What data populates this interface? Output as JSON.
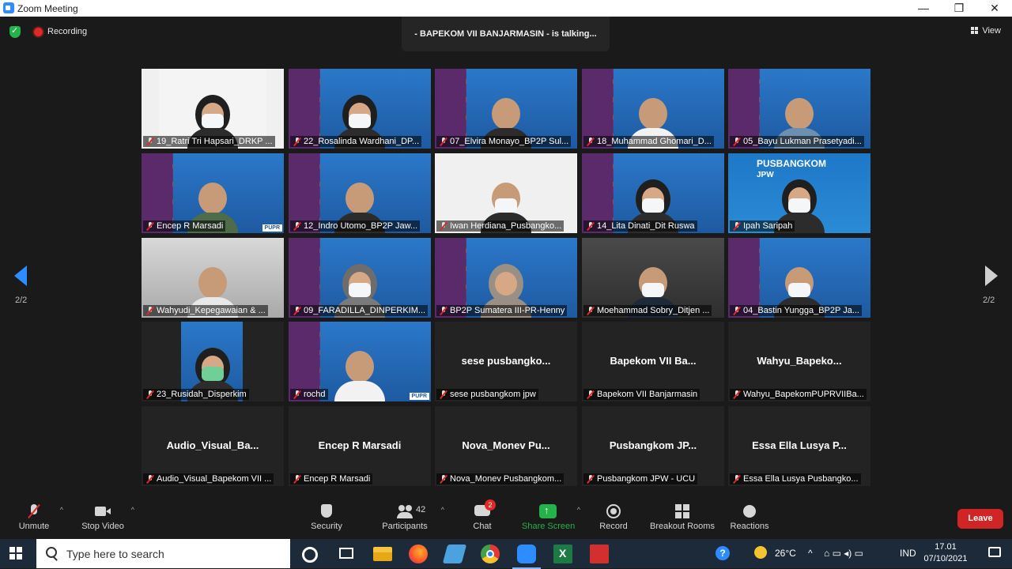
{
  "window": {
    "title": "Zoom Meeting"
  },
  "top": {
    "recording_label": "Recording",
    "talking": "- BAPEKOM VII BANJARMASIN - is talking...",
    "view_label": "View"
  },
  "pager": {
    "left": "2/2",
    "right": "2/2"
  },
  "tiles": [
    {
      "label": "19_Ratri Tri Hapsari_DRKP ..."
    },
    {
      "label": "22_Rosalinda Wardhani_DP..."
    },
    {
      "label": "07_Elvira Monayo_BP2P Sul..."
    },
    {
      "label": "18_Muhammad Ghomari_D..."
    },
    {
      "label": "05_Bayu Lukman Prasetyadi..."
    },
    {
      "label": "Encep R Marsadi"
    },
    {
      "label": "12_Indro Utomo_BP2P Jaw..."
    },
    {
      "label": "Iwan Herdiana_Pusbangko..."
    },
    {
      "label": "14_Lita Dinati_Dit Ruswa"
    },
    {
      "label": "Ipah Saripah"
    },
    {
      "label": "Wahyudi_Kepegawaian & ..."
    },
    {
      "label": "09_FARADILLA_DINPERKIM..."
    },
    {
      "label": "BP2P Sumatera III-PR-Henny"
    },
    {
      "label": "Moehammad Sobry_Ditjen ..."
    },
    {
      "label": "04_Bastin Yungga_BP2P Ja..."
    },
    {
      "label": "23_Rusidah_Disperkim"
    },
    {
      "label": "rochd"
    },
    {
      "label": "sese pusbangkom jpw",
      "display": "sese  pusbangko..."
    },
    {
      "label": "Bapekom VII Banjarmasin",
      "display": "Bapekom  VII  Ba..."
    },
    {
      "label": "Wahyu_BapekomPUPRVIIBa...",
      "display": "Wahyu_Bapeko..."
    },
    {
      "label": "Audio_Visual_Bapekom VII ...",
      "display": "Audio_Visual_Ba..."
    },
    {
      "label": "Encep R Marsadi",
      "display": "Encep R Marsadi"
    },
    {
      "label": "Nova_Monev Pusbangkom...",
      "display": "Nova_Monev  Pu..."
    },
    {
      "label": "Pusbangkom JPW - UCU",
      "display": "Pusbangkom  JP..."
    },
    {
      "label": "Essa Ella Lusya Pusbangko...",
      "display": "Essa Ella Lusya P..."
    }
  ],
  "overlays": {
    "jpw_title": "PUSBANGKOM",
    "jpw_sub": "JPW",
    "pupr": "PUPR"
  },
  "toolbar": {
    "unmute": "Unmute",
    "stop_video": "Stop Video",
    "security": "Security",
    "participants": "Participants",
    "participants_count": "42",
    "chat": "Chat",
    "chat_badge": "2",
    "share_screen": "Share Screen",
    "record": "Record",
    "breakout_rooms": "Breakout Rooms",
    "reactions": "Reactions",
    "leave": "Leave"
  },
  "taskbar": {
    "search_placeholder": "Type here to search",
    "temperature": "26°C",
    "language": "IND",
    "time": "17.01",
    "date": "07/10/2021"
  },
  "colors": {
    "accent": "#2d8cff",
    "leave": "#d12525",
    "share": "#24b24a",
    "muted": "#e02828"
  }
}
